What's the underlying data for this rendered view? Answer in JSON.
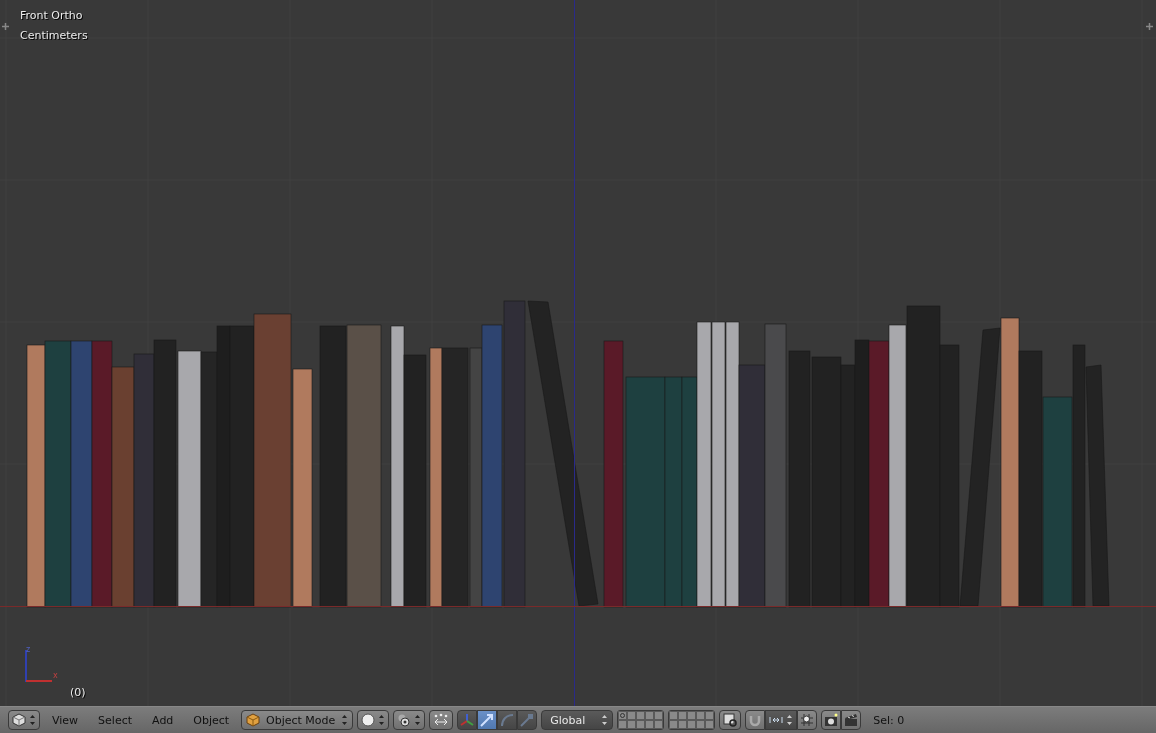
{
  "viewport": {
    "view_name": "Front Ortho",
    "units": "Centimeters",
    "frame": "(0)",
    "axes": [
      {
        "kind": "z",
        "label": "z"
      },
      {
        "kind": "x",
        "label": "x"
      }
    ]
  },
  "header": {
    "menus": [
      "View",
      "Select",
      "Add",
      "Object"
    ],
    "mode": "Object Mode",
    "manipulators": [
      {
        "kind": "widget",
        "selected": false
      },
      {
        "kind": "translate",
        "selected": true
      },
      {
        "kind": "rotate",
        "selected": false
      },
      {
        "kind": "scale",
        "selected": false
      }
    ],
    "orientation": "Global",
    "layers": [
      {
        "selected": false,
        "has_objects": true
      },
      {
        "selected": false,
        "has_objects": false
      },
      {
        "selected": false,
        "has_objects": false
      },
      {
        "selected": false,
        "has_objects": false
      },
      {
        "selected": false,
        "has_objects": false
      },
      {
        "selected": false,
        "has_objects": false
      },
      {
        "selected": false,
        "has_objects": false
      },
      {
        "selected": false,
        "has_objects": false
      },
      {
        "selected": false,
        "has_objects": false
      },
      {
        "selected": false,
        "has_objects": false
      },
      {
        "selected": false,
        "has_objects": false
      },
      {
        "selected": false,
        "has_objects": false
      },
      {
        "selected": false,
        "has_objects": false
      },
      {
        "selected": false,
        "has_objects": false
      },
      {
        "selected": false,
        "has_objects": false
      },
      {
        "selected": false,
        "has_objects": false
      },
      {
        "selected": false,
        "has_objects": false
      },
      {
        "selected": false,
        "has_objects": false
      },
      {
        "selected": false,
        "has_objects": false
      },
      {
        "selected": false,
        "has_objects": false
      }
    ],
    "snap": {
      "on": false
    },
    "selection": "Sel: 0"
  }
}
